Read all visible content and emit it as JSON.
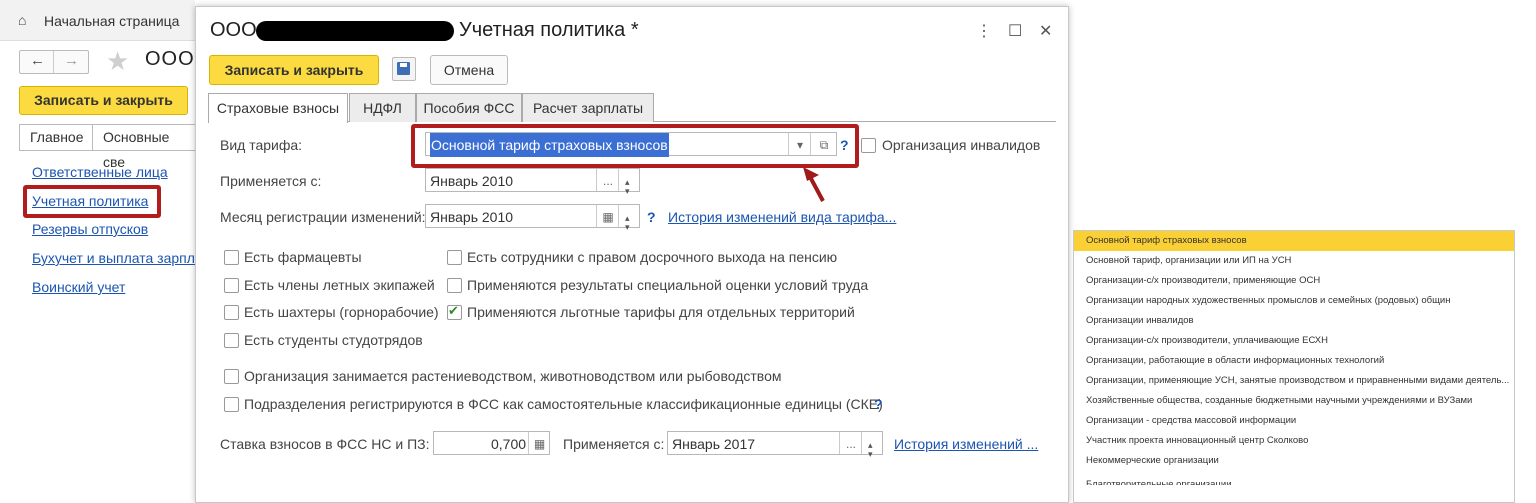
{
  "background_window": {
    "home_label": "Начальная страница",
    "nav_back": "←",
    "nav_forward": "→",
    "title_prefix": "ООО",
    "save_close": "Записать и закрыть",
    "tabs": [
      "Главное",
      "Основные све"
    ],
    "links": [
      "Ответственные лица",
      "Учетная политика",
      "Резервы отпусков",
      "Бухучет и выплата зарпл",
      "Воинский учет"
    ]
  },
  "dialog": {
    "title_prefix": "ООО",
    "title_suffix": "Учетная политика *",
    "menu_icon": "⋮",
    "maximize_icon": "☐",
    "close_icon": "✕",
    "save_close": "Записать и закрыть",
    "cancel": "Отмена",
    "tabs": [
      "Страховые взносы",
      "НДФЛ",
      "Пособия ФСС",
      "Расчет зарплаты"
    ],
    "tariff_label": "Вид тарифа:",
    "tariff_value": "Основной тариф страховых взносов",
    "disabled_org_label": "Организация инвалидов",
    "applies_from_label": "Применяется с:",
    "applies_from_value": "Январь 2010",
    "reg_month_label": "Месяц регистрации изменений:",
    "reg_month_value": "Январь 2010",
    "tariff_history_link": "История изменений вида тарифа...",
    "question": "?",
    "checkboxes_left": [
      {
        "label": "Есть фармацевты",
        "checked": false
      },
      {
        "label": "Есть члены летных экипажей",
        "checked": false
      },
      {
        "label": "Есть шахтеры (горнорабочие)",
        "checked": false
      },
      {
        "label": "Есть студенты студотрядов",
        "checked": false
      }
    ],
    "checkboxes_right": [
      {
        "label": "Есть сотрудники с правом досрочного выхода на пенсию",
        "checked": false
      },
      {
        "label": "Применяются результаты специальной оценки условий труда",
        "checked": false
      },
      {
        "label": "Применяются льготные тарифы для отдельных территорий",
        "checked": true
      }
    ],
    "agri_label": "Организация занимается растениеводством, животноводством или рыбоводством",
    "fss_units_label": "Подразделения регистрируются в ФСС как самостоятельные классификационные единицы (СКЕ)",
    "rate_label": "Ставка взносов в ФСС НС и ПЗ:",
    "rate_value": "0,700",
    "rate_applies_label": "Применяется с:",
    "rate_applies_value": "Январь 2017",
    "rate_history_link": "История изменений ..."
  },
  "dropdown": {
    "items": [
      "Основной тариф страховых взносов",
      "Основной тариф, организации или ИП на УСН",
      "Организации-с/х производители, применяющие ОСН",
      "Организации народных художественных промыслов и семейных (родовых) общин",
      "Организации инвалидов",
      "Организации-с/х производители, уплачивающие ЕСХН",
      "Организации, работающие в области информационных технологий",
      "Организации, применяющие УСН, занятые производством и приравненными видами деятель...",
      "Хозяйственные общества, созданные бюджетными научными учреждениями и ВУЗами",
      "Организации - средства массовой информации",
      "Участник проекта инновационный центр Сколково",
      "Некоммерческие организации",
      "Благотворительные организации"
    ],
    "selected_index": 0
  },
  "colors": {
    "accent_yellow": "#fbdb3f",
    "highlight_red": "#b11c1c",
    "link_blue": "#1c55b0",
    "selection_blue": "#3b6fd3"
  }
}
